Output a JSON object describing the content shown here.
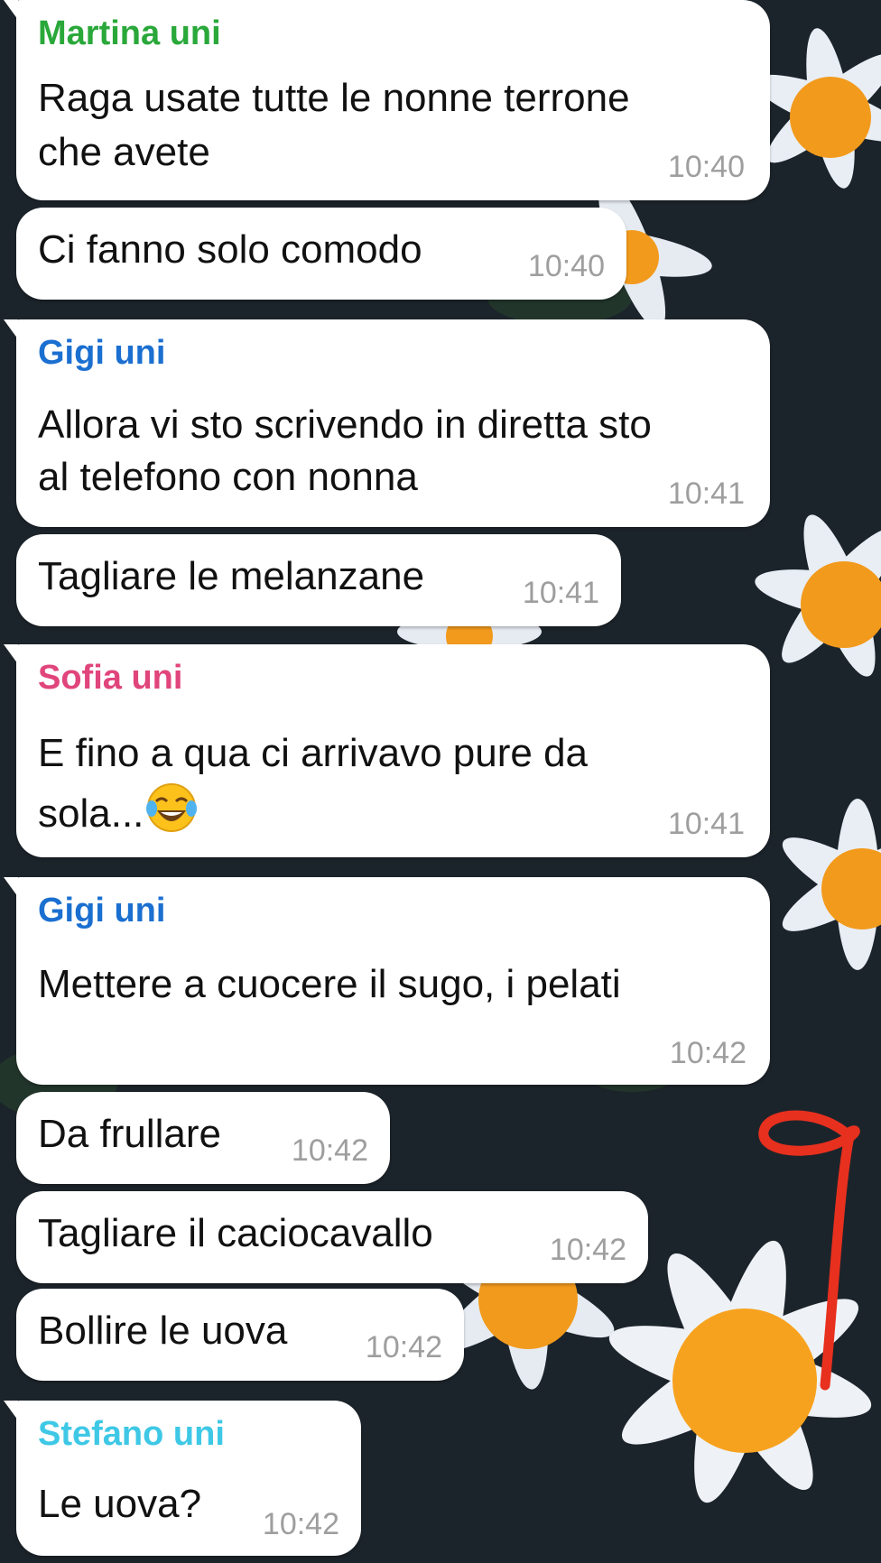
{
  "messages": [
    {
      "sender": "Martina uni",
      "sender_color": "#2aa83a",
      "lines": [
        "Raga usate tutte le nonne terrone",
        "che avete"
      ],
      "time": "10:40"
    },
    {
      "lines": [
        "Ci fanno solo comodo"
      ],
      "time": "10:40"
    },
    {
      "sender": "Gigi uni",
      "sender_color": "#1b6fd0",
      "lines": [
        "Allora vi sto scrivendo in diretta sto",
        "al telefono con nonna"
      ],
      "time": "10:41"
    },
    {
      "lines": [
        "Tagliare le melanzane"
      ],
      "time": "10:41"
    },
    {
      "sender": "Sofia uni",
      "sender_color": "#e0457b",
      "lines": [
        "E fino a qua ci arrivavo pure da",
        "sola..."
      ],
      "emoji": "tears-of-joy",
      "time": "10:41"
    },
    {
      "sender": "Gigi uni",
      "sender_color": "#1b6fd0",
      "lines": [
        "Mettere a cuocere il sugo, i pelati"
      ],
      "time": "10:42"
    },
    {
      "lines": [
        "Da frullare"
      ],
      "time": "10:42"
    },
    {
      "lines": [
        "Tagliare il caciocavallo"
      ],
      "time": "10:42"
    },
    {
      "lines": [
        "Bollire le uova"
      ],
      "time": "10:42"
    },
    {
      "sender": "Stefano uni",
      "sender_color": "#3ec8e6",
      "lines": [
        "Le uova?"
      ],
      "time": "10:42"
    }
  ],
  "annotation": {
    "color": "#e8301e",
    "icon": "hand-drawn-red-scribble"
  }
}
